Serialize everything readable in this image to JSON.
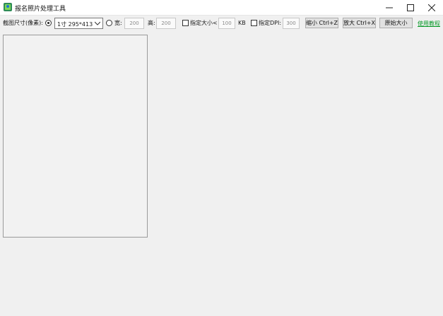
{
  "window": {
    "title": "报名照片处理工具",
    "app_icon": "photo-app-icon",
    "controls": [
      "minimize-icon",
      "maximize-icon",
      "close-icon"
    ]
  },
  "toolbar": {
    "crop_size_label": "截图尺寸(像素):",
    "preset_selected": "1寸  295*413",
    "width_label": "宽:",
    "width_value": "200",
    "height_label": "高:",
    "height_value": "200",
    "size_check_label": "指定大小<",
    "size_value": "100",
    "size_unit": "KB",
    "dpi_check_label": "指定DPI:",
    "dpi_value": "300",
    "shrink_button": "缩小 Ctrl+Z",
    "enlarge_button": "放大 Ctrl+X",
    "original_button": "原始大小",
    "tutorial_link": "使用教程"
  },
  "state": {
    "preset_radio_selected": true,
    "custom_radio_selected": false,
    "size_checked": false,
    "dpi_checked": false
  },
  "colors": {
    "background": "#f0f0f0",
    "link": "#0a9a2a"
  }
}
